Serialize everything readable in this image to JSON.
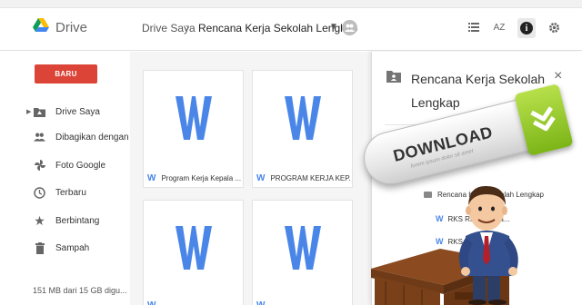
{
  "header": {
    "app_name": "Drive",
    "breadcrumb_root": "Drive Saya",
    "breadcrumb_separator": "›",
    "breadcrumb_current": "Rencana Kerja Sekolah Lengkap",
    "sort_label": "AZ",
    "info_label": "i"
  },
  "sidebar": {
    "new_button": "BARU",
    "items": [
      {
        "label": "Drive Saya",
        "icon": "drive-folder-icon"
      },
      {
        "label": "Dibagikan dengan saya",
        "icon": "people-icon"
      },
      {
        "label": "Foto Google",
        "icon": "pinwheel-icon"
      },
      {
        "label": "Terbaru",
        "icon": "clock-icon"
      },
      {
        "label": "Berbintang",
        "icon": "star-icon"
      },
      {
        "label": "Sampah",
        "icon": "trash-icon"
      }
    ],
    "storage": "151 MB dari 15 GB digu..."
  },
  "files": [
    {
      "name": "Program Kerja Kepala ...",
      "type": "word"
    },
    {
      "name": "PROGRAM KERJA KEP...",
      "type": "word"
    },
    {
      "name": "",
      "type": "word"
    },
    {
      "name": "",
      "type": "word"
    }
  ],
  "details": {
    "title": "Rencana Kerja Sekolah Lengkap",
    "close": "×",
    "tree": {
      "folder": "Rencana Kerja Sekolah Lengkap",
      "items": [
        "RKS RKAS Kerja...",
        "RKS R..."
      ]
    }
  },
  "download_banner": {
    "label": "DOWNLOAD",
    "tagline": "lorem ipsum dolor sit amet"
  },
  "colors": {
    "new_button": "#db4437",
    "word_blue": "#4a86e8",
    "download_green": "#8cc63f"
  }
}
